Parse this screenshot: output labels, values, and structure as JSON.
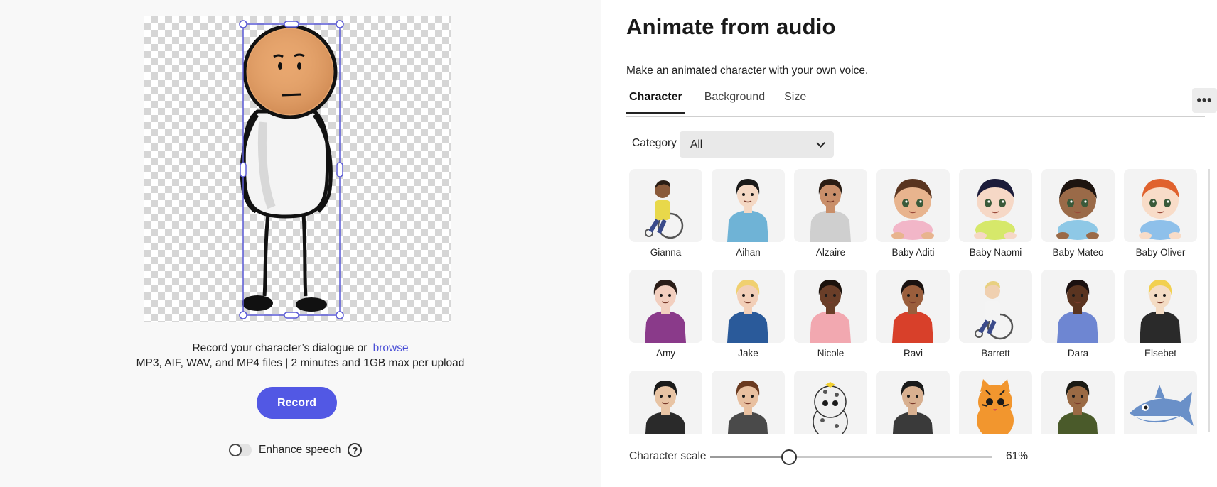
{
  "stage": {
    "upload_prompt": "Record your character’s dialogue or",
    "browse_link": "browse",
    "formats": "MP3, AIF, WAV, and MP4 files | 2 minutes and 1GB max per upload",
    "record_label": "Record",
    "enhance_label": "Enhance speech",
    "enhance_on": false,
    "help_glyph": "?"
  },
  "panel": {
    "title": "Animate from audio",
    "subtitle": "Make an animated character with your own voice.",
    "tabs": [
      {
        "label": "Character",
        "active": true
      },
      {
        "label": "Background",
        "active": false
      },
      {
        "label": "Size",
        "active": false
      }
    ],
    "more_glyph": "•••",
    "category_label": "Category",
    "category_value": "All",
    "characters": [
      {
        "name": "Gianna",
        "skin": "#8a5a3a",
        "hair": "#2a1d14",
        "shirt": "#e8d84a",
        "kind": "wheelchair"
      },
      {
        "name": "Aihan",
        "skin": "#f4d8c4",
        "hair": "#1a1a1a",
        "shirt": "#6fb3d6",
        "kind": "person"
      },
      {
        "name": "Alzaire",
        "skin": "#c98f6a",
        "hair": "#2a1d14",
        "shirt": "#cfcfcf",
        "kind": "person"
      },
      {
        "name": "Baby Aditi",
        "skin": "#e8b48e",
        "hair": "#5a3520",
        "shirt": "#f2b6c8",
        "kind": "baby"
      },
      {
        "name": "Baby Naomi",
        "skin": "#f6d8c6",
        "hair": "#1c1c3a",
        "shirt": "#d6e86a",
        "kind": "baby"
      },
      {
        "name": "Baby Mateo",
        "skin": "#9a6a48",
        "hair": "#1d1410",
        "shirt": "#8ec8e6",
        "kind": "baby"
      },
      {
        "name": "Baby Oliver",
        "skin": "#f8dcc8",
        "hair": "#e0622e",
        "shirt": "#8ec0ea",
        "kind": "baby"
      },
      {
        "name": "Amy",
        "skin": "#f2cfbf",
        "hair": "#2a1d18",
        "shirt": "#8a3a8a",
        "kind": "person"
      },
      {
        "name": "Jake",
        "skin": "#f2cfb8",
        "hair": "#f0d070",
        "shirt": "#2a5a9a",
        "kind": "person"
      },
      {
        "name": "Nicole",
        "skin": "#6a3e28",
        "hair": "#1c120c",
        "shirt": "#f2a8b0",
        "kind": "person"
      },
      {
        "name": "Ravi",
        "skin": "#9a5e3c",
        "hair": "#1a1210",
        "shirt": "#d8402a",
        "kind": "person"
      },
      {
        "name": "Barrett",
        "skin": "#f0d0b0",
        "hair": "#e8d080",
        "shirt": "#f4f4f4",
        "kind": "wheelchair"
      },
      {
        "name": "Dara",
        "skin": "#5a3420",
        "hair": "#1a1010",
        "shirt": "#6e86d2",
        "kind": "person"
      },
      {
        "name": "Elsebet",
        "skin": "#f4dcc4",
        "hair": "#f2d050",
        "shirt": "#2a2a2a",
        "kind": "person"
      },
      {
        "name": "",
        "skin": "#e8c4a4",
        "hair": "#1a1a1a",
        "shirt": "#2a2a2a",
        "kind": "person"
      },
      {
        "name": "",
        "skin": "#e8c0a0",
        "hair": "#6a3a20",
        "shirt": "#4a4a4a",
        "kind": "person"
      },
      {
        "name": "",
        "skin": "#f0f0f0",
        "hair": "#f2d030",
        "shirt": "#f0f0f0",
        "kind": "leopard"
      },
      {
        "name": "",
        "skin": "#d8b090",
        "hair": "#1a1a1a",
        "shirt": "#3a3a3a",
        "kind": "person"
      },
      {
        "name": "",
        "skin": "#f2962e",
        "hair": "#f2962e",
        "shirt": "#f2962e",
        "kind": "cat"
      },
      {
        "name": "",
        "skin": "#9a6a44",
        "hair": "#1a1a14",
        "shirt": "#4a5a2a",
        "kind": "person"
      },
      {
        "name": "",
        "skin": "#6a90c8",
        "hair": "#6a90c8",
        "shirt": "#6a90c8",
        "kind": "shark"
      }
    ],
    "scale_label": "Character scale",
    "scale_value": "61%",
    "scale_fraction": 0.28
  },
  "colors": {
    "accent": "#5258e4",
    "selection": "#5a5ad6",
    "character_face": "#e8a66e"
  }
}
